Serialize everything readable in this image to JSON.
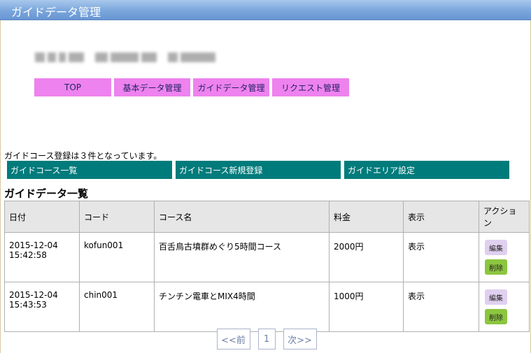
{
  "header": {
    "title": "ガイドデータ管理"
  },
  "nav": {
    "items": [
      {
        "label": "TOP"
      },
      {
        "label": "基本データ管理"
      },
      {
        "label": "ガイドデータ管理"
      },
      {
        "label": "リクエスト管理"
      }
    ]
  },
  "summary": {
    "text": "ガイドコース登録は３件となっています。"
  },
  "subnav": {
    "items": [
      {
        "label": "ガイドコース一覧"
      },
      {
        "label": "ガイドコース新規登録"
      },
      {
        "label": "ガイドエリア設定"
      }
    ]
  },
  "section": {
    "title": "ガイドデータ一覧"
  },
  "table": {
    "headers": [
      "日付",
      "コード",
      "コース名",
      "料金",
      "表示",
      "アクション"
    ],
    "edit_label": "編集",
    "delete_label": "削除",
    "rows": [
      {
        "date": "2015-12-04",
        "time": "15:42:58",
        "code": "kofun001",
        "name": "百舌鳥古墳群めぐり5時間コース",
        "fee": "2000円",
        "display": "表示"
      },
      {
        "date": "2015-12-04",
        "time": "15:43:53",
        "code": "chin001",
        "name": "チンチン電車とMIX4時間",
        "fee": "1000円",
        "display": "表示"
      }
    ]
  },
  "pager": {
    "prev": "<<前",
    "page": "1",
    "next": "次>>"
  }
}
